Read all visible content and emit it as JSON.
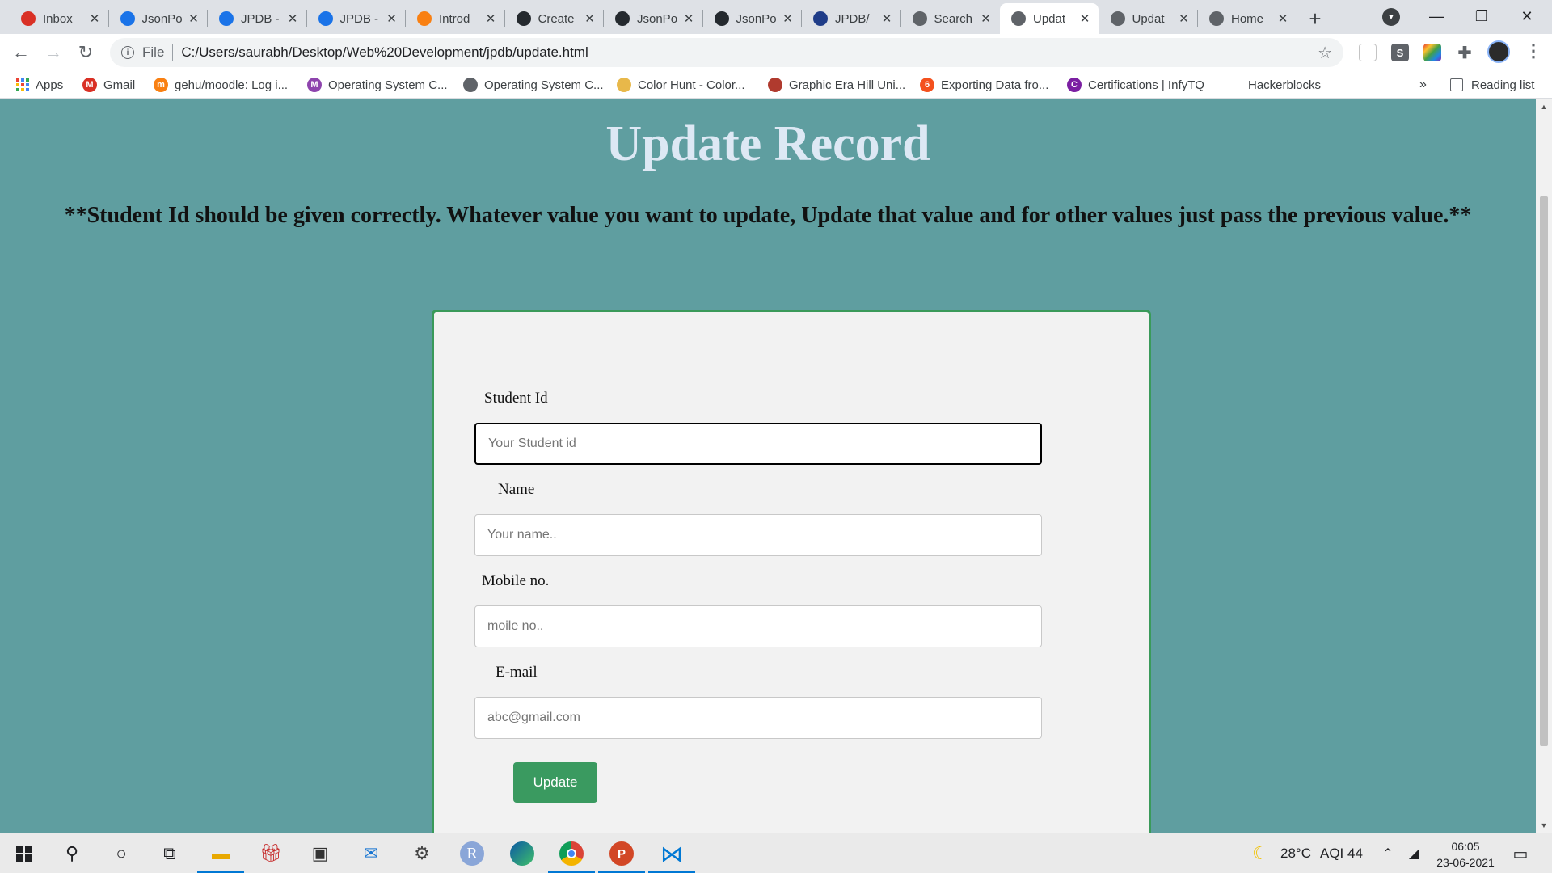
{
  "tabs": [
    {
      "title": "Inbox",
      "icon": "gmail-icon",
      "color": "#d93025"
    },
    {
      "title": "JsonPo",
      "icon": "jsonpowerdb-icon",
      "color": "#1a73e8"
    },
    {
      "title": "JPDB -",
      "icon": "jsonpowerdb-icon",
      "color": "#1a73e8"
    },
    {
      "title": "JPDB -",
      "icon": "jsonpowerdb-icon",
      "color": "#1a73e8"
    },
    {
      "title": "Introd",
      "icon": "moodle-icon",
      "color": "#f98012"
    },
    {
      "title": "Create",
      "icon": "github-icon",
      "color": "#24292e"
    },
    {
      "title": "JsonPo",
      "icon": "github-icon",
      "color": "#24292e"
    },
    {
      "title": "JsonPo",
      "icon": "github-icon",
      "color": "#24292e"
    },
    {
      "title": "JPDB/",
      "icon": "checkmark-icon",
      "color": "#1f3c88"
    },
    {
      "title": "Search",
      "icon": "globe-icon",
      "color": "#5f6368"
    },
    {
      "title": "Updat",
      "icon": "globe-icon",
      "color": "#5f6368",
      "active": true
    },
    {
      "title": "Updat",
      "icon": "globe-icon",
      "color": "#5f6368"
    },
    {
      "title": "Home",
      "icon": "globe-icon",
      "color": "#5f6368"
    }
  ],
  "address": {
    "scheme": "File",
    "url": "C:/Users/saurabh/Desktop/Web%20Development/jpdb/update.html"
  },
  "bookmarks": [
    {
      "label": "Apps",
      "icon": "apps-grid-icon"
    },
    {
      "label": "Gmail",
      "icon": "gmail-icon",
      "color": "#d93025",
      "glyph": "M"
    },
    {
      "label": "gehu/moodle: Log i...",
      "icon": "moodle-icon",
      "color": "#f98012",
      "glyph": "m"
    },
    {
      "label": "Operating System C...",
      "icon": "letter-m-icon",
      "color": "#8e44ad",
      "glyph": "M"
    },
    {
      "label": "Operating System C...",
      "icon": "globe-icon",
      "color": "#5f6368",
      "glyph": ""
    },
    {
      "label": "Color Hunt - Color...",
      "icon": "colorhunt-icon",
      "color": "#e8b84a",
      "glyph": ""
    },
    {
      "label": "Graphic Era Hill Uni...",
      "icon": "university-icon",
      "color": "#b03a2e",
      "glyph": ""
    },
    {
      "label": "Exporting Data fro...",
      "icon": "exporting-icon",
      "color": "#f4511e",
      "glyph": "6"
    },
    {
      "label": "Certifications | InfyTQ",
      "icon": "infytq-icon",
      "color": "#7b1fa2",
      "glyph": "C"
    },
    {
      "label": "Hackerblocks",
      "icon": "",
      "color": "",
      "glyph": ""
    }
  ],
  "reading_list": "Reading list",
  "page": {
    "title": "Update Record",
    "note": "**Student Id should be given correctly. Whatever value you want to update, Update that value and for other values just pass the previous value.**"
  },
  "form": {
    "student_id": {
      "label": "Student Id",
      "placeholder": "Your Student id"
    },
    "name": {
      "label": "Name",
      "placeholder": "Your name.."
    },
    "mobile": {
      "label": "Mobile no.",
      "placeholder": "moile no.."
    },
    "email": {
      "label": "E-mail",
      "placeholder": "abc@gmail.com"
    },
    "submit_label": "Update"
  },
  "taskbar": {
    "weather": "28°C",
    "aqi": "AQI 44",
    "time": "06:05",
    "date": "23-06-2021"
  },
  "colors": {
    "page_background": "#5f9ea0",
    "card_border": "#3a9a5a",
    "button": "#3a9a60",
    "title": "#dde8f4"
  }
}
